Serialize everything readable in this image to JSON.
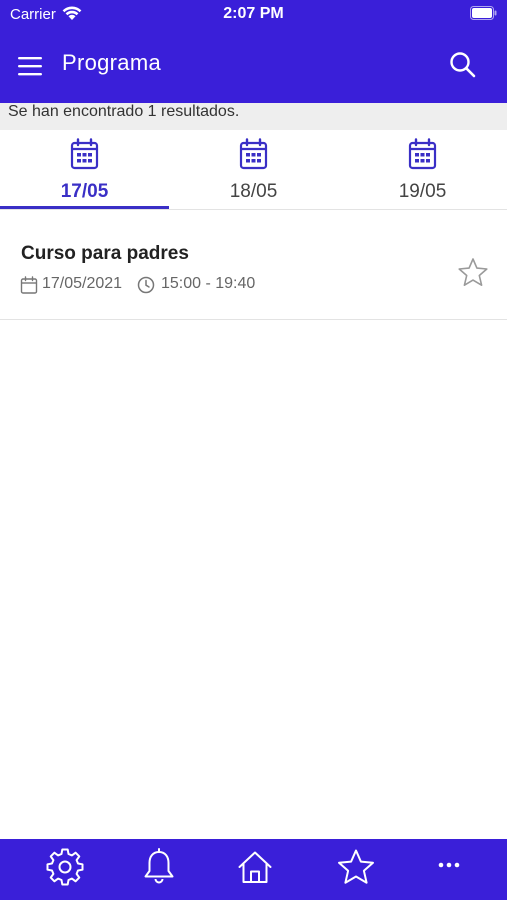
{
  "status_bar": {
    "carrier": "Carrier",
    "time": "2:07 PM"
  },
  "app_bar": {
    "title": "Programa",
    "menu_icon": "hamburger-menu-icon",
    "search_icon": "search-icon"
  },
  "results_text": "Se han encontrado 1 resultados.",
  "tabs": [
    {
      "label": "17/05",
      "icon": "calendar-icon",
      "active": true
    },
    {
      "label": "18/05",
      "icon": "calendar-icon",
      "active": false
    },
    {
      "label": "19/05",
      "icon": "calendar-icon",
      "active": false
    }
  ],
  "events": [
    {
      "title": "Curso para padres",
      "date": "17/05/2021",
      "time": "15:00 - 19:40",
      "favorite": false
    }
  ],
  "bottom_nav": [
    {
      "icon": "settings-gear-icon"
    },
    {
      "icon": "bell-icon"
    },
    {
      "icon": "home-icon"
    },
    {
      "icon": "star-icon"
    },
    {
      "icon": "more-dots-icon"
    }
  ],
  "colors": {
    "brand": "#3a1fd9",
    "accent": "#3a2fc6",
    "results_background": "#eeeeee"
  }
}
